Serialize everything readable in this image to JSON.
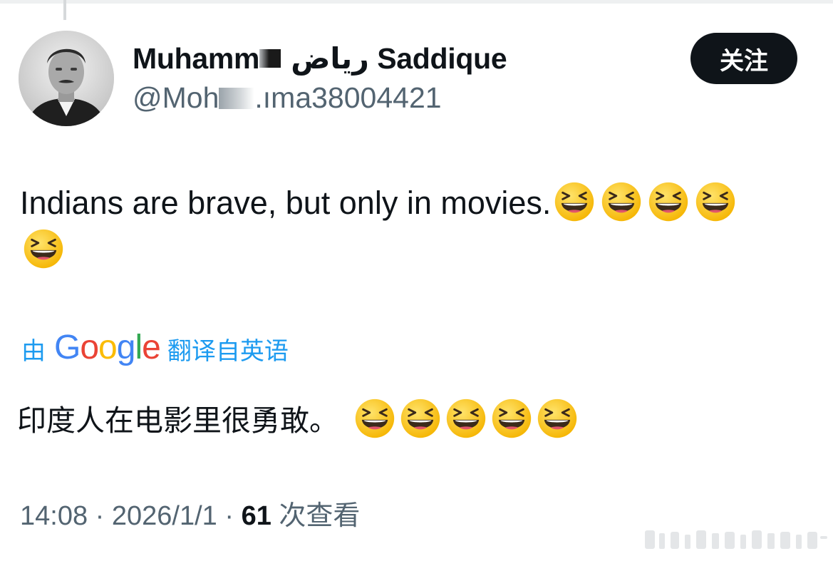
{
  "user": {
    "display_name_start": "Muhamm",
    "display_name_arabic": "رياض",
    "display_name_end": "Saddique",
    "handle_start": "@Moh",
    "handle_end": ".ıma38004421"
  },
  "follow_button": {
    "label": "关注"
  },
  "tweet": {
    "text": "Indians are brave, but only in movies.",
    "emoji_icon": "grinning-squinting-face-icon",
    "emoji_count": 5
  },
  "translation": {
    "prefix": "由",
    "provider": "Google",
    "suffix": "翻译自英语",
    "text": "印度人在电影里很勇敢。",
    "emoji_count": 5
  },
  "meta": {
    "time": "14:08",
    "separator": "·",
    "date": "2026/1/1",
    "views_count": "61",
    "views_label": "次查看"
  },
  "colors": {
    "accent": "#1d9bf0",
    "text_primary": "#0f1419",
    "text_secondary": "#536471",
    "follow_bg": "#0f1419"
  }
}
